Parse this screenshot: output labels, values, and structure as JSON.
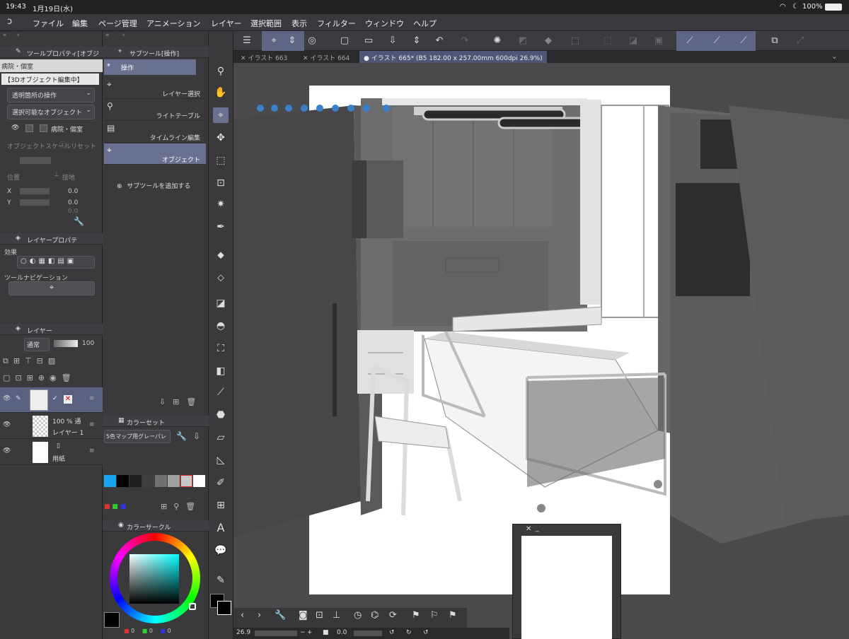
{
  "status": {
    "time": "19:43",
    "date": "1月19日(水)",
    "battery": "100%"
  },
  "menu": [
    "ファイル",
    "編集",
    "ページ管理",
    "アニメーション",
    "レイヤー",
    "選択範囲",
    "表示",
    "フィルター",
    "ウィンドウ",
    "ヘルプ"
  ],
  "tool_property": {
    "title": "ツールプロパティ[オブジ",
    "preview": "病院・個室",
    "mode_label": "【3Dオブジェクト編集中】",
    "transparent_op": "透明箇所の操作",
    "selectable": "選択可能なオブジェクト",
    "object_name": "病院・個室",
    "object_scale": "オブジェクトスケール",
    "reset": "リセット",
    "position": "位置",
    "ground": "接地",
    "x_label": "X",
    "x_value": "0.0",
    "y_label": "Y",
    "y_value": "0.0",
    "z_value": "0.0"
  },
  "layer_property": {
    "title": "レイヤープロパテ",
    "effect": "効果",
    "tool_nav": "ツールナビゲーション"
  },
  "layer_panel": {
    "title": "レイヤー",
    "blend": "通常",
    "opacity": "100",
    "layers": [
      {
        "name": "",
        "info": ""
      },
      {
        "name": "レイヤー 1",
        "info": "100 % 通"
      },
      {
        "name": "用紙",
        "info": ""
      }
    ]
  },
  "subtool": {
    "title": "サブツール[操作]",
    "header": "操作",
    "items": [
      "レイヤー選択",
      "ライトテーブル",
      "タイムライン編集",
      "オブジェクト"
    ],
    "add": "サブツールを追加する"
  },
  "color_set": {
    "title": "カラーセット",
    "name": "5色マップ用グレーパレ"
  },
  "color_circle": {
    "title": "カラーサークル",
    "values": [
      "0",
      "0",
      "0"
    ]
  },
  "tabs": [
    {
      "label": "イラスト 663"
    },
    {
      "label": "イラスト 664"
    },
    {
      "label": "イラスト 665* (B5 182.00 x 257.00mm 600dpi 26.9%)"
    }
  ],
  "bottom": {
    "zoom": "26.9",
    "angle": "0.0"
  },
  "colors": {
    "accent": "#5f6585",
    "swatches": [
      "#1aa3f0",
      "#000000",
      "#202020",
      "#404040",
      "#707070",
      "#a0a0a0",
      "#c8c8c8",
      "#ffffff",
      "#ffffff"
    ]
  }
}
